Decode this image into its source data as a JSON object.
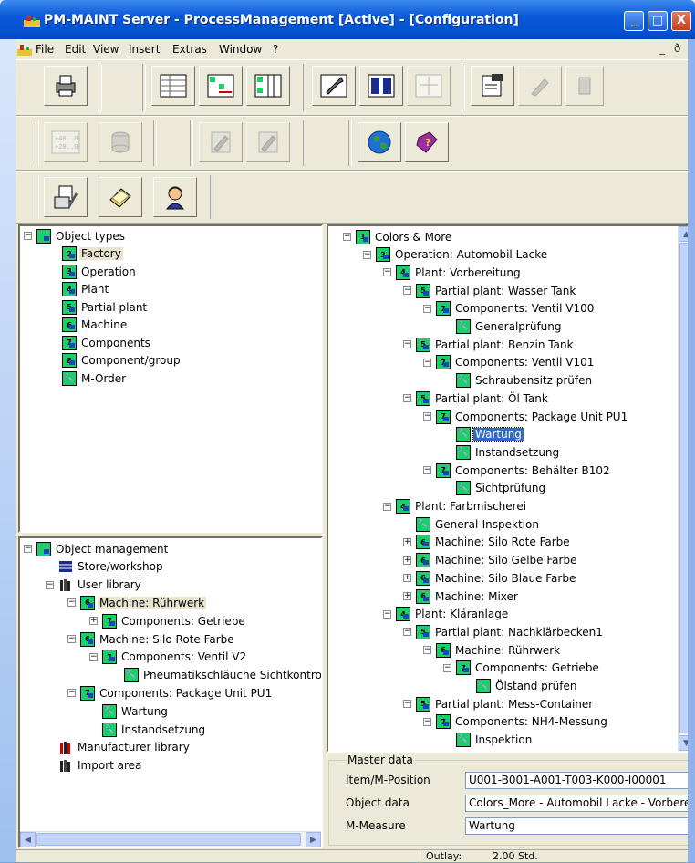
{
  "window": {
    "title": "PM-MAINT Server - ProcessManagement [Active] - [Configuration]",
    "controls": {
      "minimize": "_",
      "maximize": "□",
      "close": "X"
    }
  },
  "menu": {
    "items": [
      "File",
      "Edit",
      "View",
      "Insert",
      "Extras",
      "Window",
      "?"
    ],
    "mdi_controls": {
      "minimize": "_",
      "restore": "ð"
    }
  },
  "object_types": {
    "root": "Object types",
    "items": [
      {
        "label": "Factory",
        "badge": "2",
        "selected": true
      },
      {
        "label": "Operation",
        "badge": "3"
      },
      {
        "label": "Plant",
        "badge": "4"
      },
      {
        "label": "Partial plant",
        "badge": "5"
      },
      {
        "label": "Machine",
        "badge": "6"
      },
      {
        "label": "Components",
        "badge": "7"
      },
      {
        "label": "Component/group",
        "badge": "8"
      },
      {
        "label": "M-Order",
        "badge": ""
      }
    ]
  },
  "object_management": {
    "root": "Object management",
    "items": [
      {
        "label": "Store/workshop",
        "depth": 1,
        "icon": "store-icon"
      },
      {
        "label": "User library",
        "depth": 1,
        "icon": "library-icon"
      },
      {
        "label": "Machine: Rührwerk",
        "depth": 2,
        "badge": "6",
        "selected": true
      },
      {
        "label": "Components: Getriebe",
        "depth": 3,
        "badge": "7"
      },
      {
        "label": "Machine: Silo Rote Farbe",
        "depth": 2,
        "badge": "6"
      },
      {
        "label": "Components: Ventil V2",
        "depth": 3,
        "badge": "7"
      },
      {
        "label": "Pneumatikschläuche Sichtkontrolle",
        "depth": 4,
        "badge": ""
      },
      {
        "label": "Components: Package Unit PU1",
        "depth": 2,
        "badge": "7"
      },
      {
        "label": "Wartung",
        "depth": 3,
        "badge": ""
      },
      {
        "label": "Instandsetzung",
        "depth": 3,
        "badge": ""
      },
      {
        "label": "Manufacturer library",
        "depth": 1,
        "icon": "manufacturer-library-icon"
      },
      {
        "label": "Import area",
        "depth": 1,
        "icon": "import-icon"
      }
    ]
  },
  "config_tree": {
    "items": [
      {
        "label": "Colors & More",
        "depth": 0,
        "badge": "1"
      },
      {
        "label": "Operation: Automobil Lacke",
        "depth": 1,
        "badge": "3"
      },
      {
        "label": "Plant: Vorbereitung",
        "depth": 2,
        "badge": "4"
      },
      {
        "label": "Partial plant: Wasser Tank",
        "depth": 3,
        "badge": "5"
      },
      {
        "label": "Components: Ventil V100",
        "depth": 4,
        "badge": "7"
      },
      {
        "label": "Generalprüfung",
        "depth": 5,
        "badge": ""
      },
      {
        "label": "Partial plant: Benzin Tank",
        "depth": 3,
        "badge": "5"
      },
      {
        "label": "Components: Ventil V101",
        "depth": 4,
        "badge": "7"
      },
      {
        "label": "Schraubensitz prüfen",
        "depth": 5,
        "badge": ""
      },
      {
        "label": "Partial plant: Öl Tank",
        "depth": 3,
        "badge": "5"
      },
      {
        "label": "Components: Package Unit PU1",
        "depth": 4,
        "badge": "7"
      },
      {
        "label": "Wartung",
        "depth": 5,
        "badge": "",
        "focused": true
      },
      {
        "label": "Instandsetzung",
        "depth": 5,
        "badge": ""
      },
      {
        "label": "Components: Behälter B102",
        "depth": 4,
        "badge": "7"
      },
      {
        "label": "Sichtprüfung",
        "depth": 5,
        "badge": ""
      },
      {
        "label": "Plant: Farbmischerei",
        "depth": 2,
        "badge": "4"
      },
      {
        "label": "General-Inspektion",
        "depth": 3,
        "badge": ""
      },
      {
        "label": "Machine: Silo Rote Farbe",
        "depth": 3,
        "badge": "6"
      },
      {
        "label": "Machine: Silo Gelbe Farbe",
        "depth": 3,
        "badge": "6"
      },
      {
        "label": "Machine: Silo Blaue Farbe",
        "depth": 3,
        "badge": "6"
      },
      {
        "label": "Machine: Mixer",
        "depth": 3,
        "badge": "6"
      },
      {
        "label": "Plant: Kläranlage",
        "depth": 2,
        "badge": "4"
      },
      {
        "label": "Partial plant: Nachklärbecken1",
        "depth": 3,
        "badge": "5"
      },
      {
        "label": "Machine: Rührwerk",
        "depth": 4,
        "badge": "6"
      },
      {
        "label": "Components: Getriebe",
        "depth": 5,
        "badge": "7"
      },
      {
        "label": "Ölstand prüfen",
        "depth": 6,
        "badge": ""
      },
      {
        "label": "Partial plant: Mess-Container",
        "depth": 3,
        "badge": "5"
      },
      {
        "label": "Components: NH4-Messung",
        "depth": 4,
        "badge": "7"
      },
      {
        "label": "Inspektion",
        "depth": 5,
        "badge": ""
      }
    ]
  },
  "master_data": {
    "group_label": "Master data",
    "rows": [
      {
        "key": "Item/M-Position",
        "value": "U001-B001-A001-T003-K000-I00001"
      },
      {
        "key": "Object data",
        "value": "Colors_More - Automobil Lacke - Vorbereitung"
      },
      {
        "key": "M-Measure",
        "value": "Wartung"
      }
    ]
  },
  "status": {
    "label": "Outlay:",
    "value": "2.00 Std."
  },
  "colors": {
    "title_bar": "#0452d0",
    "node_icon": "#19d06a",
    "selection": "#316ac5"
  }
}
